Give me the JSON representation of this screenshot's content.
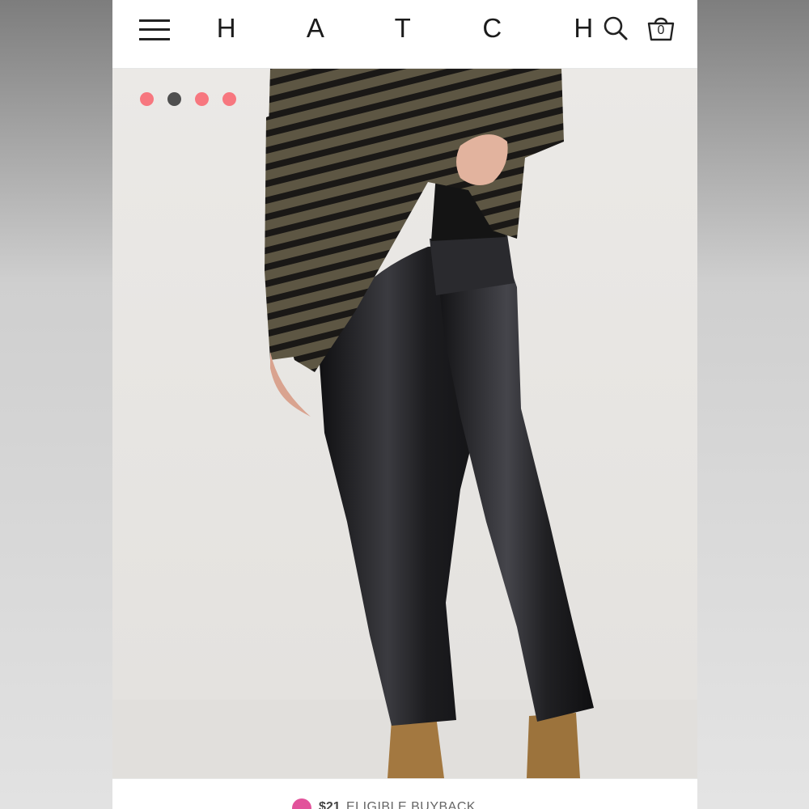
{
  "header": {
    "logo": "H A T C H",
    "cart_count": "0",
    "icons": [
      "hamburger-menu-icon",
      "search-icon",
      "shopping-bag-icon"
    ]
  },
  "carousel": {
    "dot_count": 4,
    "active_index": 1,
    "dot_colors": [
      "#f7777f",
      "#4f4f4f",
      "#f7777f",
      "#f7777f"
    ]
  },
  "product_image": {
    "subject": "model wearing striped long-sleeve top and black faux leather cropped flare pants with tan suede boots"
  },
  "buyback": {
    "price": "$21",
    "label": "ELIGIBLE BUYBACK",
    "icon": "buyback-badge-icon"
  },
  "colors": {
    "brand_text": "#1b1b1b",
    "buyback_pink": "#e2539b",
    "stripe_olive": "#5d5643",
    "stripe_black": "#1a1816",
    "leather": "#1e1e20",
    "boot_tan": "#a37840"
  }
}
